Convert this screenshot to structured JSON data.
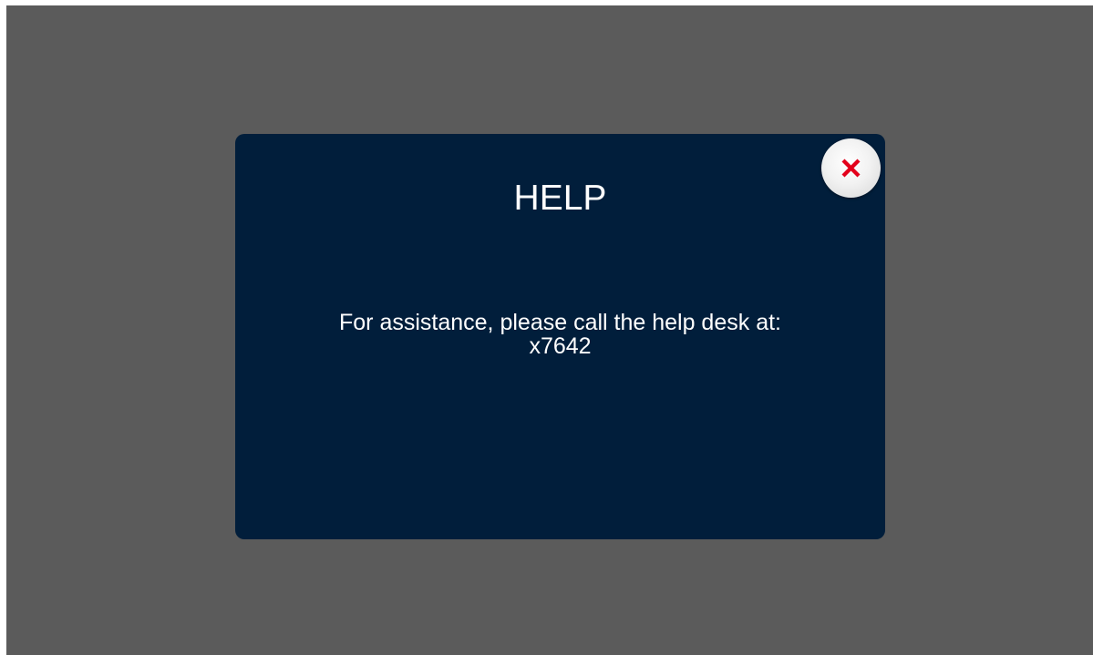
{
  "dialog": {
    "title": "HELP",
    "message_line1": "For assistance, please call the help desk at:",
    "message_line2": "x7642"
  },
  "close_button": {
    "icon": "close-icon",
    "icon_color": "#e3001b"
  },
  "colors": {
    "backdrop": "#5b5b5b",
    "dialog_background": "#011e3b",
    "text": "#ffffff"
  }
}
